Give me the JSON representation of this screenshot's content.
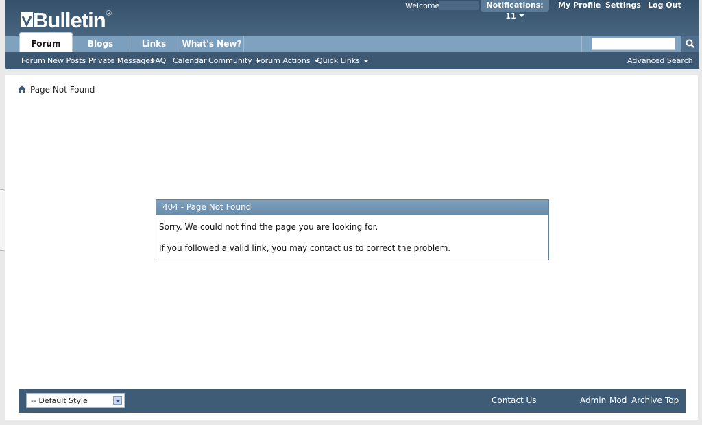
{
  "header": {
    "logo_text": "Bulletin",
    "logo_mark": "®",
    "welcome": "Welcome,",
    "notifications": "Notifications: 11",
    "links": [
      "My Profile",
      "Settings",
      "Log Out"
    ]
  },
  "tabs": [
    {
      "label": "Forum",
      "active": true
    },
    {
      "label": "Blogs"
    },
    {
      "label": "Links"
    },
    {
      "label": "What's New?"
    }
  ],
  "search": {
    "placeholder": "",
    "icon": "search-icon"
  },
  "nav": {
    "items": [
      "Forum",
      "New Posts",
      "Private Messages",
      "FAQ",
      "Calendar"
    ],
    "menus": [
      "Community",
      "Forum Actions",
      "Quick Links"
    ],
    "advanced_search": "Advanced Search"
  },
  "breadcrumb": {
    "label": "Page Not Found",
    "icon": "home-icon"
  },
  "error_panel": {
    "title": "404 - Page Not Found",
    "line1": "Sorry. We could not find the page you are looking for.",
    "line2": "If you followed a valid link, you may contact us to correct the problem."
  },
  "footer": {
    "style_select": "-- Default Style",
    "contact": "Contact Us",
    "links": [
      "Admin",
      "Mod",
      "Archive",
      "Top"
    ]
  },
  "colors": {
    "header_bg": "#3e5c78",
    "tab_bg": "#7fa2bf",
    "nav_bg": "#3c5873",
    "footer_bg": "#3f5c77",
    "panel_head": "#7496b4"
  }
}
